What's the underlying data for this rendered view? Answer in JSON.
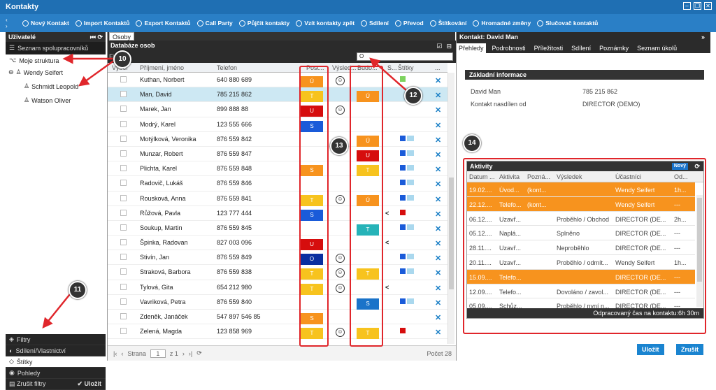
{
  "window": {
    "title": "Kontakty"
  },
  "toolbar": [
    {
      "label": "Nový Kontakt",
      "icon": "plus-icon"
    },
    {
      "label": "Import Kontaktů",
      "icon": "import-icon"
    },
    {
      "label": "Export Kontaktů",
      "icon": "export-icon"
    },
    {
      "label": "Call Party",
      "icon": "phone-icon"
    },
    {
      "label": "Půjčit kontakty",
      "icon": "lend-icon"
    },
    {
      "label": "Vzít kontakty zpět",
      "icon": "undo-icon"
    },
    {
      "label": "Sdílení",
      "icon": "share-icon"
    },
    {
      "label": "Převod",
      "icon": "transfer-icon"
    },
    {
      "label": "Štítkování",
      "icon": "tag-icon"
    },
    {
      "label": "Hromadné změny",
      "icon": "bulk-icon"
    },
    {
      "label": "Slučovač kontaktů",
      "icon": "merge-icon"
    }
  ],
  "left": {
    "header": "Uživatelé",
    "items": [
      "Seznam spolupracovníků",
      "Moje struktura"
    ],
    "tree": [
      "Wendy Seifert",
      "Schmidt Leopold",
      "Watson Oliver"
    ],
    "bottom": [
      "Filtry",
      "Sdílení/Vlastnictví",
      "Štítky",
      "Pohledy"
    ],
    "reset": "Zrušit filtry",
    "save": "Uložit"
  },
  "center": {
    "tab": "Osoby",
    "title": "Databáze osob",
    "filter": "Fil",
    "search": "O",
    "columns": [
      "Výber",
      "Příjmení, jméno",
      "Telefon",
      "Post...",
      "Výsled...",
      "Budo...",
      "S...",
      "Štítky",
      "..."
    ],
    "rows": [
      {
        "name": "Kuthan, Norbert",
        "phone": "640 880 689",
        "post": "Ú",
        "postColor": "#f7931e",
        "smile": true,
        "budo": "",
        "budoColor": "",
        "share": false,
        "tag": "#7dd35f",
        "tag2": false
      },
      {
        "name": "Man, David",
        "phone": "785 215 862",
        "post": "T",
        "postColor": "#f7c31e",
        "smile": false,
        "budo": "Ú",
        "budoColor": "#f7931e",
        "share": false,
        "tag": "",
        "tag2": false
      },
      {
        "name": "Marek, Jan",
        "phone": "899 888 88",
        "post": "U",
        "postColor": "#d60d0d",
        "smile": true,
        "budo": "",
        "budoColor": "",
        "share": false,
        "tag": "",
        "tag2": false
      },
      {
        "name": "Modrý, Karel",
        "phone": "123 555 666",
        "post": "S",
        "postColor": "#1a5bd9",
        "smile": false,
        "budo": "",
        "budoColor": "",
        "share": false,
        "tag": "",
        "tag2": false
      },
      {
        "name": "Motýlková, Veronika",
        "phone": "876 559 842",
        "post": "",
        "postColor": "",
        "smile": false,
        "budo": "Ú",
        "budoColor": "#f7931e",
        "share": false,
        "tag": "#1a5bd9",
        "tag2": true
      },
      {
        "name": "Munzar, Robert",
        "phone": "876 559 847",
        "post": "",
        "postColor": "",
        "smile": false,
        "budo": "U",
        "budoColor": "#d60d0d",
        "share": false,
        "tag": "#1a5bd9",
        "tag2": true
      },
      {
        "name": "Plichta, Karel",
        "phone": "876 559 848",
        "post": "S",
        "postColor": "#f7931e",
        "smile": false,
        "budo": "T",
        "budoColor": "#f7c31e",
        "share": false,
        "tag": "#1a5bd9",
        "tag2": true
      },
      {
        "name": "Radovič, Lukáš",
        "phone": "876 559 846",
        "post": "",
        "postColor": "",
        "smile": false,
        "budo": "",
        "budoColor": "",
        "share": false,
        "tag": "#1a5bd9",
        "tag2": true
      },
      {
        "name": "Rousková, Anna",
        "phone": "876 559 841",
        "post": "T",
        "postColor": "#f7c31e",
        "smile": true,
        "budo": "Ú",
        "budoColor": "#f7931e",
        "share": false,
        "tag": "#1a5bd9",
        "tag2": true
      },
      {
        "name": "Růžová, Pavla",
        "phone": "123 777 444",
        "post": "S",
        "postColor": "#1a5bd9",
        "smile": false,
        "budo": "",
        "budoColor": "",
        "share": true,
        "tag": "#d60d0d",
        "tag2": false
      },
      {
        "name": "Soukup, Martin",
        "phone": "876 559 845",
        "post": "",
        "postColor": "",
        "smile": false,
        "budo": "T",
        "budoColor": "#26b3b8",
        "share": false,
        "tag": "#1a5bd9",
        "tag2": true
      },
      {
        "name": "Špinka, Radovan",
        "phone": "827 003 096",
        "post": "U",
        "postColor": "#d60d0d",
        "smile": false,
        "budo": "",
        "budoColor": "",
        "share": true,
        "tag": "",
        "tag2": false
      },
      {
        "name": "Stivín, Jan",
        "phone": "876 559 849",
        "post": "O",
        "postColor": "#0a2fa0",
        "smile": true,
        "budo": "",
        "budoColor": "",
        "share": false,
        "tag": "#1a5bd9",
        "tag2": true
      },
      {
        "name": "Straková, Barbora",
        "phone": "876 559 838",
        "post": "T",
        "postColor": "#f7c31e",
        "smile": true,
        "budo": "T",
        "budoColor": "#f7c31e",
        "share": false,
        "tag": "#1a5bd9",
        "tag2": true
      },
      {
        "name": "Tylová, Gita",
        "phone": "654 212 980",
        "post": "T",
        "postColor": "#f7c31e",
        "smile": true,
        "budo": "",
        "budoColor": "",
        "share": true,
        "tag": "",
        "tag2": false
      },
      {
        "name": "Vavriková, Petra",
        "phone": "876 559 840",
        "post": "",
        "postColor": "",
        "smile": false,
        "budo": "S",
        "budoColor": "#1a73c9",
        "share": false,
        "tag": "#1a5bd9",
        "tag2": true
      },
      {
        "name": "Zdeněk, Janáček",
        "phone": "547 897 546 85",
        "post": "S",
        "postColor": "#f7931e",
        "smile": false,
        "budo": "",
        "budoColor": "",
        "share": false,
        "tag": "",
        "tag2": false
      },
      {
        "name": "Zelená, Magda",
        "phone": "123 858 969",
        "post": "T",
        "postColor": "#f7c31e",
        "smile": true,
        "budo": "T",
        "budoColor": "#f7c31e",
        "share": false,
        "tag": "#d60d0d",
        "tag2": false
      }
    ],
    "pager": {
      "label": "Strana",
      "page": "1",
      "of": "z 1",
      "count": "Počet 28"
    }
  },
  "right": {
    "title": "Kontakt: David Man",
    "tabs": [
      "Přehledy",
      "Podrobnosti",
      "Příležitosti",
      "Sdílení",
      "Poznámky",
      "Seznam úkolů"
    ],
    "section": "Základní informace",
    "info": [
      {
        "k": "David Man",
        "v": "785 215 862"
      },
      {
        "k": "Kontakt nasdílen od",
        "v": "DIRECTOR (DEMO)"
      }
    ],
    "activities": {
      "title": "Aktivity",
      "new": "Nový",
      "columns": [
        "Datum ...",
        "Aktivita",
        "Pozná...",
        "Výsledek",
        "Účastníci",
        "Od..."
      ],
      "rows": [
        {
          "d": "19.02....",
          "a": "Úvod...",
          "p": "(kont...",
          "r": "",
          "u": "Wendy Seifert",
          "o": "1h...",
          "hl": true
        },
        {
          "d": "22.12....",
          "a": "Telefo...",
          "p": "(kont...",
          "r": "",
          "u": "Wendy Seifert",
          "o": "---",
          "hl": true
        },
        {
          "d": "06.12....",
          "a": "Uzavř...",
          "p": "",
          "r": "Proběhlo / Obchod",
          "u": "DIRECTOR (DE...",
          "o": "2h...",
          "hl": false
        },
        {
          "d": "05.12....",
          "a": "Naplá...",
          "p": "",
          "r": "Splněno",
          "u": "DIRECTOR (DE...",
          "o": "---",
          "hl": false
        },
        {
          "d": "28.11....",
          "a": "Uzavř...",
          "p": "",
          "r": "Neproběhlo",
          "u": "DIRECTOR (DE...",
          "o": "---",
          "hl": false
        },
        {
          "d": "20.11....",
          "a": "Uzavř...",
          "p": "",
          "r": "Proběhlo / odmít...",
          "u": "Wendy Seifert",
          "o": "1h...",
          "hl": false
        },
        {
          "d": "15.09....",
          "a": "Telefo...",
          "p": "",
          "r": "",
          "u": "DIRECTOR (DE...",
          "o": "---",
          "hl": true
        },
        {
          "d": "12.09....",
          "a": "Telefo...",
          "p": "",
          "r": "Dovoláno / zavol...",
          "u": "DIRECTOR (DE...",
          "o": "---",
          "hl": false
        },
        {
          "d": "05.09....",
          "a": "Schůz...",
          "p": "",
          "r": "Proběhlo / nyní n...",
          "u": "DIRECTOR (DE...",
          "o": "---",
          "hl": false
        }
      ],
      "footer": "Odpracovaný čas na kontaktu:6h 30m"
    },
    "save": "Uložit",
    "cancel": "Zrušit"
  },
  "callouts": [
    "10",
    "11",
    "12",
    "13",
    "14"
  ]
}
